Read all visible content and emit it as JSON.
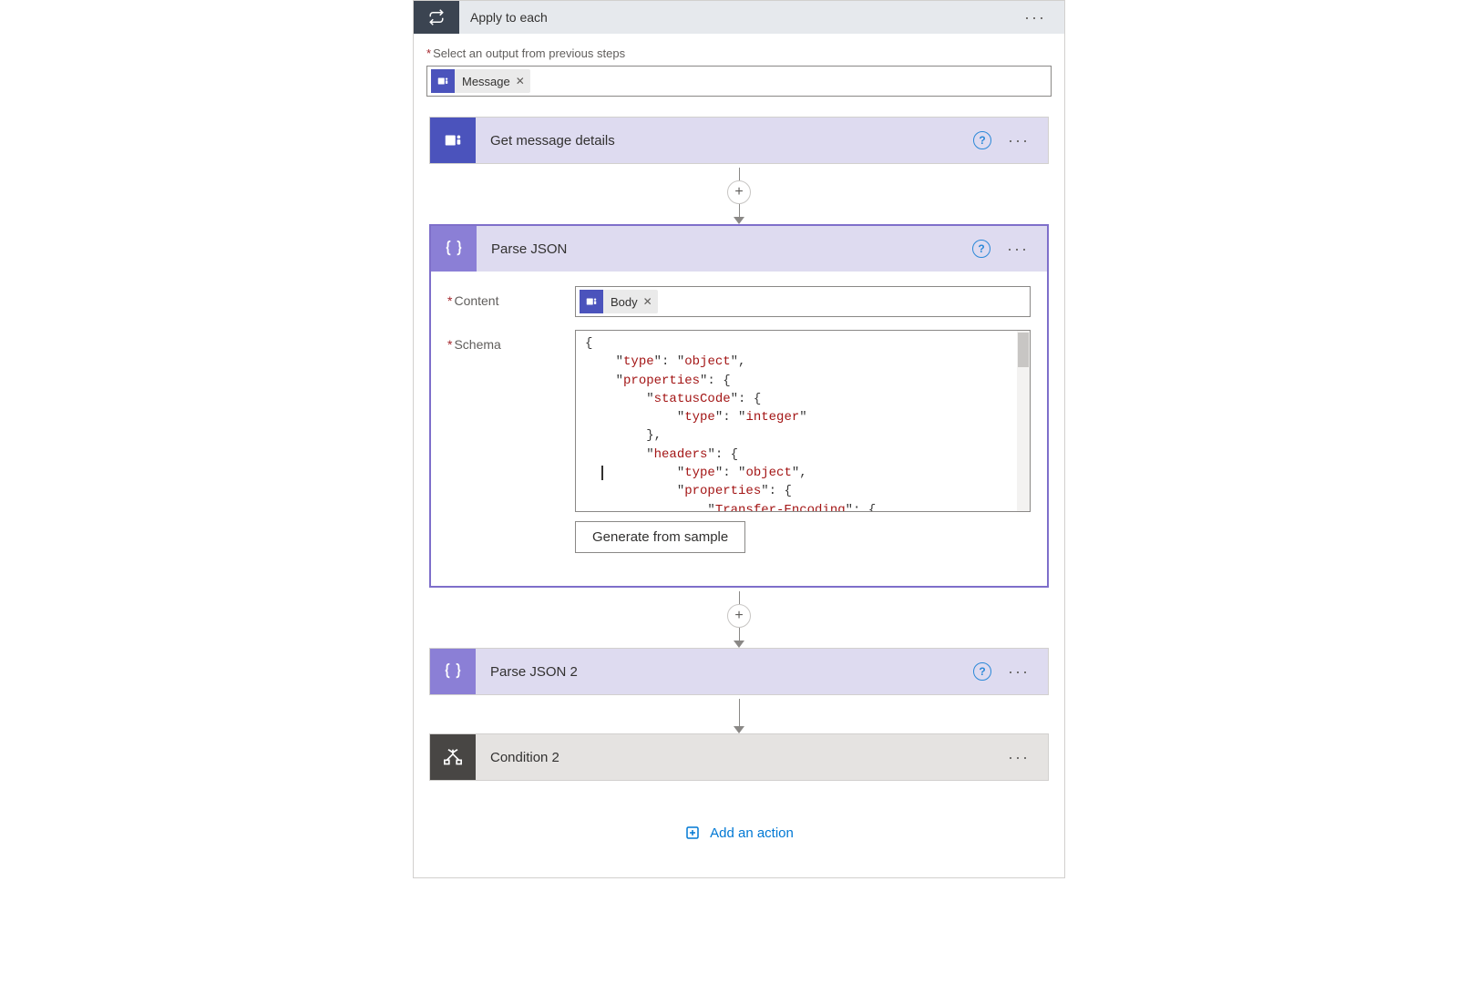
{
  "outer": {
    "title": "Apply to each",
    "select_label": "Select an output from previous steps",
    "token_label": "Message"
  },
  "step1": {
    "title": "Get message details"
  },
  "parse": {
    "title": "Parse JSON",
    "content_label": "Content",
    "content_token": "Body",
    "schema_label": "Schema",
    "generate_btn": "Generate from sample",
    "schema_lines": {
      "l1": "{",
      "l2a": "    \"",
      "l2b": "type",
      "l2c": "\": \"",
      "l2d": "object",
      "l2e": "\",",
      "l3a": "    \"",
      "l3b": "properties",
      "l3c": "\": {",
      "l4a": "        \"",
      "l4b": "statusCode",
      "l4c": "\": {",
      "l5a": "            \"",
      "l5b": "type",
      "l5c": "\": \"",
      "l5d": "integer",
      "l5e": "\"",
      "l6": "        },",
      "l7a": "        \"",
      "l7b": "headers",
      "l7c": "\": {",
      "l8a": "            \"",
      "l8b": "type",
      "l8c": "\": \"",
      "l8d": "object",
      "l8e": "\",",
      "l9a": "            \"",
      "l9b": "properties",
      "l9c": "\": {",
      "l10a": "                \"",
      "l10b": "Transfer-Encoding",
      "l10c": "\": {"
    }
  },
  "parse2": {
    "title": "Parse JSON 2"
  },
  "cond2": {
    "title": "Condition 2"
  },
  "add_action_label": "Add an action"
}
